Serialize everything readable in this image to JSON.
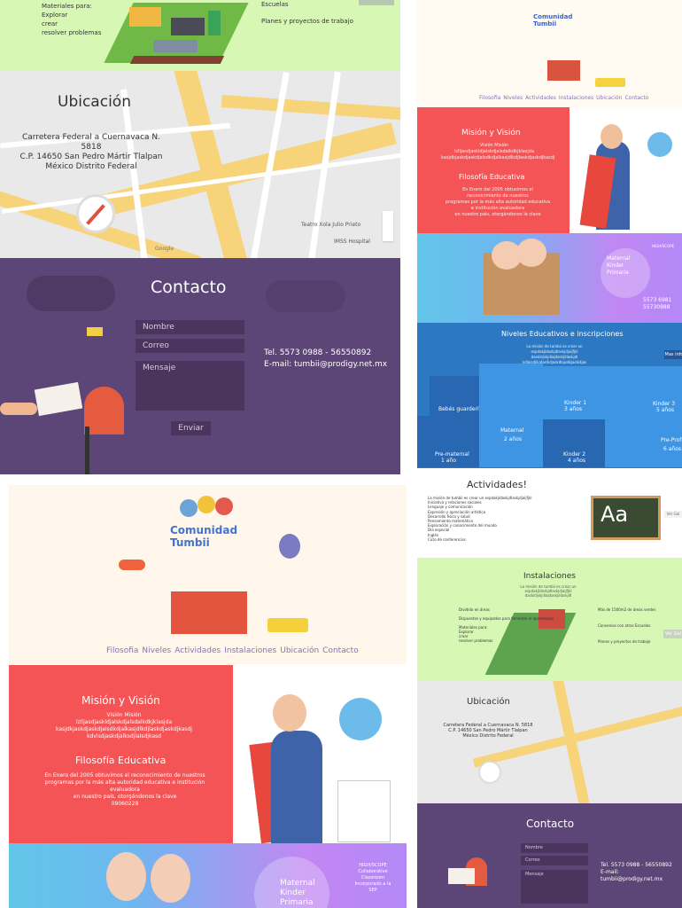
{
  "left_top": {
    "materials": {
      "title": "Materiales para:",
      "items": [
        "Explorar",
        "crear",
        "resolver problemas"
      ]
    },
    "school_text": [
      "Escuelas",
      "Planes y proyectos de trabajo"
    ]
  },
  "location": {
    "title": "Ubicación",
    "address": [
      "Carretera Federal a Cuernavaca N. 5818",
      "C.P. 14650 San Pedro Mártir Tlalpan",
      "México Distrito Federal"
    ],
    "map_labels": [
      "Teatro Xola Julio Prieto",
      "IMSS Hospital",
      "Google"
    ]
  },
  "contact": {
    "title": "Contacto",
    "fields": [
      "Nombre",
      "Correo",
      "Mensaje"
    ],
    "send": "Enviar",
    "phone": "Tel. 5573 0988 - 56550892",
    "email": "E-mail: tumbii@prodigy.net.mx"
  },
  "home": {
    "logo": "Comunidad Tumbii",
    "nav": [
      "Filosofia",
      "Niveles",
      "Actividades",
      "Instalaciones",
      "Ubicación",
      "Contacto"
    ],
    "mission_title": "Misión y Visión",
    "mission_text": [
      "Visión Misión",
      "lzlljasdjaskldjalskdjalsdalkdkjklasjda",
      "kasjdkjaskdjaskdjalsdkdjalkasjdlkdjlaskdjaskdjkasdj",
      "kdvlsdjaskdjalksdjlalsdjkasd"
    ],
    "philosophy_title": "Filosofía Educativa",
    "philosophy_text": [
      "En Enero del 2005 obtuvimos el reconocimiento de nuestros",
      "programas por la más alta autoridad educativa e institución evaluadora",
      "en nuestro país, otorgándonos la clave",
      "09060228"
    ],
    "levels": [
      "Maternal",
      "Kinder",
      "Primaria"
    ],
    "badge_title": "HIGH/SCOPE",
    "badge_text": [
      "Collaborative",
      "Classroom",
      "Incorporado a la SEP"
    ],
    "phone_small": [
      "5573 6981",
      "55730988"
    ]
  },
  "right_levels": {
    "title": "Niveles Educativos e inscripciones",
    "text": [
      "La misión de tumbii es crear un espdakjldaskjdlaskjdjaijfjkl",
      "daskldjskjdlajdaskjdlaskjdl",
      "kdlaisdjlkjdaslkdjaskdlajsdkjaslkdjas"
    ],
    "more": "Mas info",
    "tiles": [
      "Bebés guardería",
      "Maternal",
      "Kinder 1",
      "Kinder 3",
      "Pre-maternal",
      "Kinder 2",
      "Pre-Prof"
    ],
    "ages": [
      "2 años",
      "3 años",
      "4 años",
      "5 años",
      "1 año",
      "6 años"
    ]
  },
  "activities": {
    "title": "Actividades!",
    "lines": [
      "La misión de tumbii es crear un espdakjldaskjdlaskjdjaijfjkl",
      "Iniciativa y relaciones sociales",
      "Lenguaje y comunicación",
      "Expresión y apreciación artística",
      "Desarrollo físico y salud",
      "Pensamiento matemático",
      "Exploración y conocimiento del mundo",
      "Día especial",
      "Inglés",
      "Ciclo de conferencias"
    ],
    "aa": "Aa",
    "see": "Ver Gal"
  },
  "installations": {
    "title": "Instalaciones",
    "lines": [
      "La misión de tumbii es crear un espdakjldaskjdlaskjdjaijfjkl",
      "daskldjskjdlajdaskjdlaskjdl"
    ],
    "labels": [
      "Dividido en áreas",
      "Dispuestos y equipados para fomentar el aprendizaje",
      "Materiales para:",
      "Explorar",
      "crear",
      "resolver problemas",
      "Más de 1500m2 de áreas verdes",
      "Convenios con otras Escuelas",
      "Planes y proyectos de trabajo"
    ],
    "see": "Ver Gal"
  },
  "colors": {
    "red": "#f45455",
    "purple": "#5c4677",
    "green": "#d7f8b4",
    "blue": "#2d78c3",
    "violet": "#b388f7",
    "cream": "#fff6ec"
  }
}
